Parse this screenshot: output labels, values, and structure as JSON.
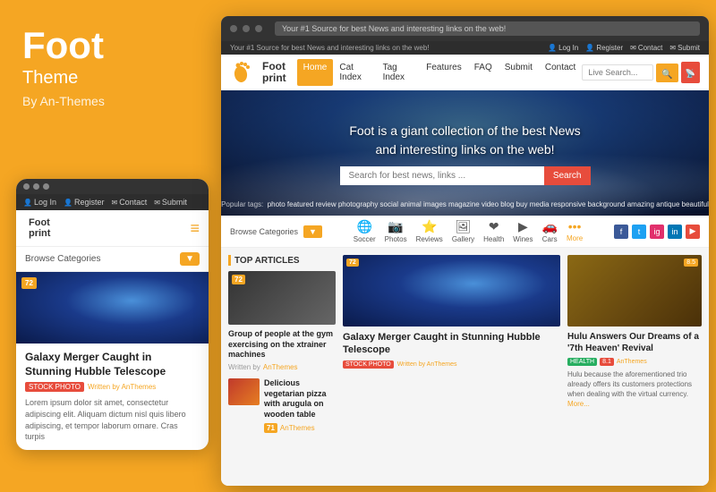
{
  "brand": {
    "title": "Foot",
    "subtitle": "Theme",
    "by": "By An-Themes"
  },
  "mobile": {
    "address": "Your #1 Source for best News and interesting links on the web!",
    "nav_items": [
      "Log In",
      "Register",
      "Contact",
      "Submit"
    ],
    "logo_text": "Foot\nprint",
    "browse_label": "Browse Categories",
    "article": {
      "badge": "72",
      "title": "Galaxy Merger Caught in Stunning Hubble Telescope",
      "tag": "STOCK PHOTO",
      "written_by": "Written by",
      "author": "AnThemes",
      "text": "Lorem ipsum dolor sit amet, consectetur adipiscing elit. Aliquam dictum nisl quis libero adipiscing, et tempor laborum ornare. Cras turpis"
    }
  },
  "desktop": {
    "address": "Your #1 Source for best News and interesting links on the web!",
    "top_links": [
      "Log In",
      "Register",
      "Contact",
      "Submit"
    ],
    "logo_text": "Foot\nprint",
    "nav_links": [
      "Home",
      "Cat Index",
      "Tag Index",
      "Features",
      "FAQ",
      "Submit",
      "Contact"
    ],
    "active_nav": "Home",
    "search_placeholder": "Live Search...",
    "hero": {
      "text_line1": "Foot is a giant collection of the best News",
      "text_line2": "and interesting links on the web!",
      "search_placeholder": "Search for best news, links ...",
      "search_btn": "Search",
      "tags_label": "Popular tags:",
      "tags": "photo  featured  review  photography  social  animal  images  magazine  video  blog  buy  media  responsive  background  amazing  antique  beautiful"
    },
    "categories": {
      "browse_label": "Browse Categories",
      "items": [
        {
          "icon": "🌐",
          "label": "Soccer"
        },
        {
          "icon": "📷",
          "label": "Photos"
        },
        {
          "icon": "⭐",
          "label": "Reviews"
        },
        {
          "icon": "🖼",
          "label": "Gallery"
        },
        {
          "icon": "❤",
          "label": "Health"
        },
        {
          "icon": "▶",
          "label": "Wines"
        },
        {
          "icon": "🚗",
          "label": "Cars"
        },
        {
          "icon": "•••",
          "label": "More"
        }
      ]
    },
    "top_articles": {
      "header": "TOP ARTICLES",
      "main": {
        "badge": "72",
        "title": "Group of people at the gym exercising on the xtrainer machines",
        "written_by": "Written by",
        "author": "AnThemes"
      },
      "secondary": {
        "badge": "71",
        "title": "Delicious vegetarian pizza with arugula on wooden table",
        "author": "AnThemes"
      }
    },
    "middle_article": {
      "badge": "72",
      "title": "Galaxy Merger Caught in Stunning Hubble Telescope",
      "tag": "STOCK PHOTO",
      "written_by": "Written by",
      "author": "AnThemes"
    },
    "right_article": {
      "badge": "8.5",
      "title": "Hulu Answers Our Dreams of a '7th Heaven' Revival",
      "tag_health": "HEALTH",
      "tag_num": "8.1",
      "author": "AnThemes",
      "text": "Hulu because the aforementioned trio already offers its customers protections when dealing with the virtual currency.",
      "more": "More..."
    }
  }
}
